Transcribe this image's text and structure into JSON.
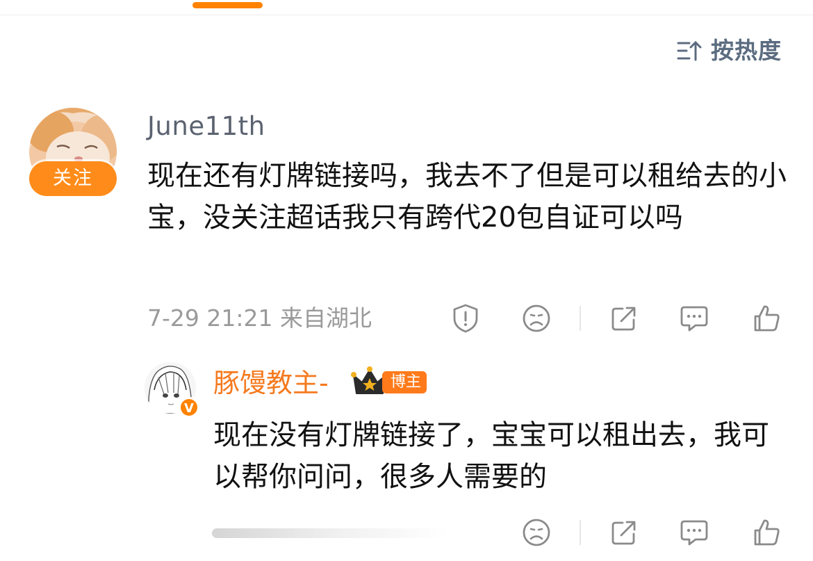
{
  "sort": {
    "label": "按热度",
    "icon": "sort-icon"
  },
  "comment": {
    "username": "June11th",
    "follow_label": "关注",
    "text": "现在还有灯牌链接吗，我去不了但是可以租给去的小宝，没关注超话我只有跨代20包自证可以吗",
    "time": "7-29 21:21",
    "location": "来自湖北",
    "actions": [
      "report-icon",
      "dislike-icon",
      "share-icon",
      "reply-icon",
      "like-icon"
    ]
  },
  "reply": {
    "username": "豚馒教主-",
    "badge": "博主",
    "verified_mark": "V",
    "text": "现在没有灯牌链接了，宝宝可以租出去，我可以帮你问问，很多人需要的",
    "actions": [
      "dislike-icon",
      "share-icon",
      "reply-icon",
      "like-icon"
    ]
  },
  "colors": {
    "accent": "#ff8200",
    "username_reply": "#f57a1f",
    "meta": "#9a9a9a",
    "icon": "#8a8a8a"
  }
}
